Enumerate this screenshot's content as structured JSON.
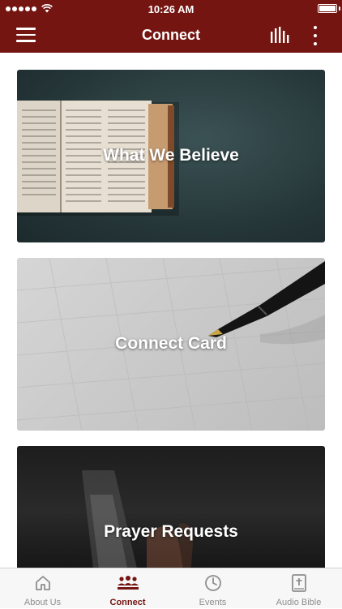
{
  "status_bar": {
    "time": "10:26 AM",
    "battery_level": 1.0
  },
  "app_bar": {
    "title": "Connect"
  },
  "icons": {
    "menu": "hamburger-menu-icon",
    "audio": "audio-bars-icon",
    "more": "more-vertical-icon",
    "signal": "signal-dots-icon",
    "wifi": "wifi-icon",
    "battery": "battery-icon"
  },
  "cards": [
    {
      "label": "What We Believe",
      "image": "open-bible-photo"
    },
    {
      "label": "Connect Card",
      "image": "pen-on-paper-photo"
    },
    {
      "label": "Prayer Requests",
      "image": "hands-in-light-photo"
    }
  ],
  "tabs": [
    {
      "label": "About Us",
      "icon": "home-icon",
      "active": false
    },
    {
      "label": "Connect",
      "icon": "group-icon",
      "active": true
    },
    {
      "label": "Events",
      "icon": "clock-icon",
      "active": false
    },
    {
      "label": "Audio Bible",
      "icon": "bible-cross-icon",
      "active": false
    }
  ],
  "colors": {
    "brand": "#741511",
    "tab_inactive": "#8e8e8e",
    "tab_bar_bg": "#f7f7f7"
  }
}
